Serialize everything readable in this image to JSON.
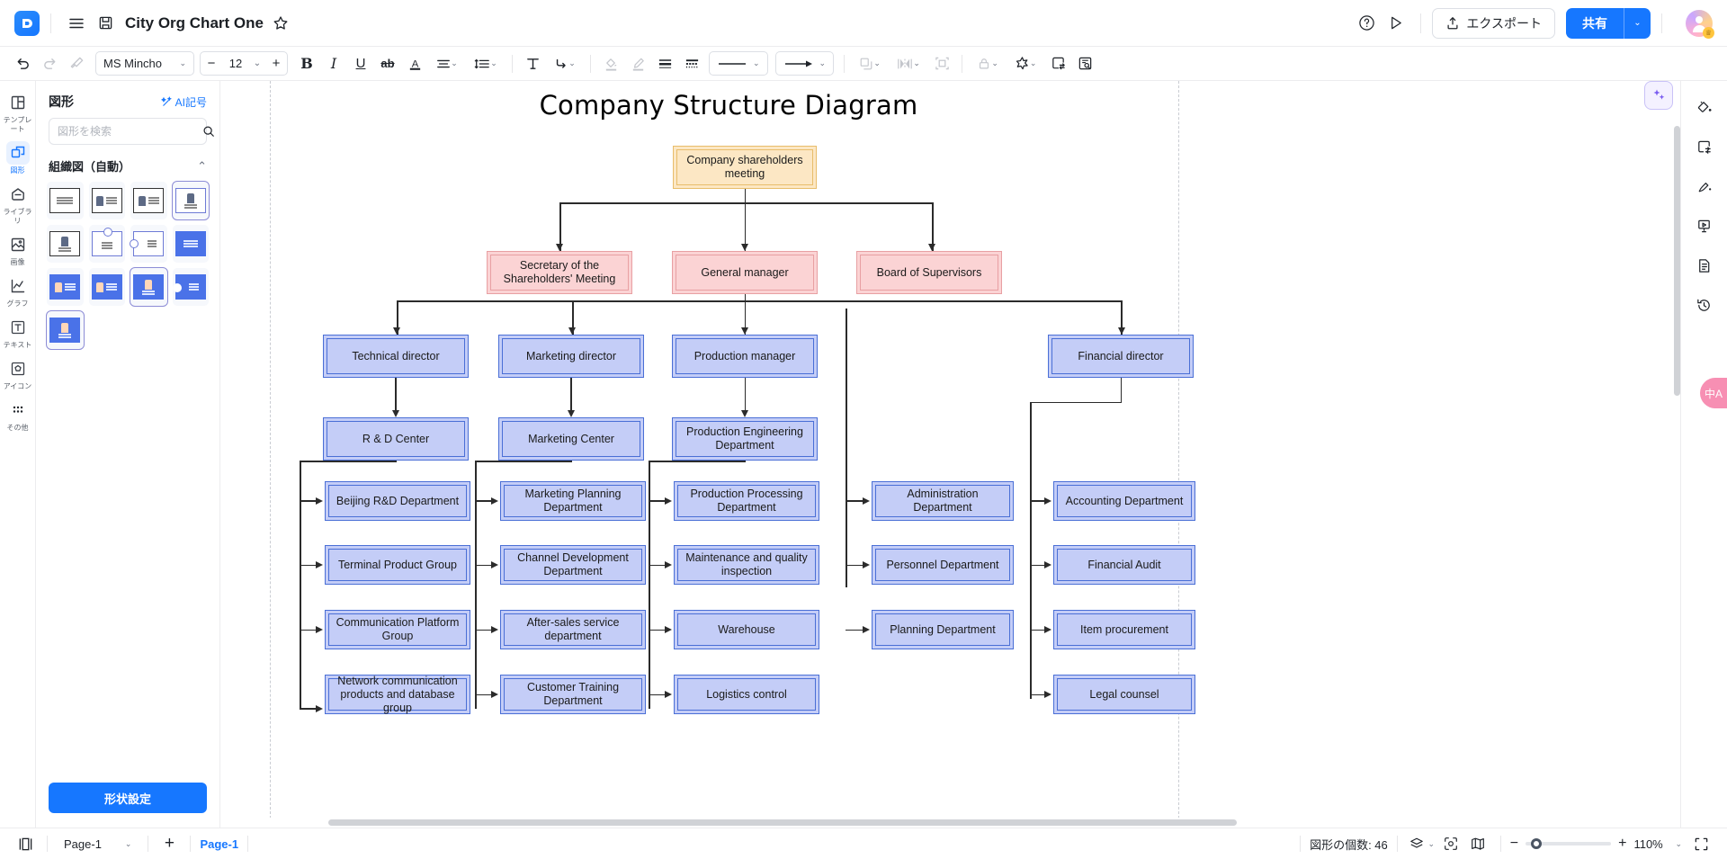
{
  "app": {
    "doc_title": "City Org Chart One",
    "logo_glyph": "⊃"
  },
  "topbar": {
    "menu_icon": "hamburger-icon",
    "save_icon": "save-icon",
    "star_icon": "★",
    "help_icon": "?",
    "present_icon": "▷",
    "export_label": "エクスポート",
    "share_label": "共有",
    "share_caret": "⌄"
  },
  "format_toolbar": {
    "undo": "↶",
    "redo": "↷",
    "format_painter": "brush-icon",
    "font_family": "MS Mincho",
    "font_size": "12",
    "minus": "−",
    "plus": "+",
    "bold": "B",
    "italic": "I",
    "underline": "U",
    "strikethrough": "ab",
    "font_color": "A",
    "align": "align-icon",
    "line_spacing": "line-spacing-icon",
    "text_box": "T",
    "connector": "connector-icon",
    "fill": "fill-icon",
    "line_color": "pen-icon",
    "line_weight": "weight-icon",
    "line_dash": "dash-icon",
    "line_style_preview": "———",
    "arrow_style_preview": "⟶",
    "arrange": "arrange-icon",
    "distribute": "distribute-icon",
    "group": "group-icon",
    "lock": "lock-icon",
    "effects": "star-effect-icon",
    "frame": "frame-icon",
    "find": "find-icon"
  },
  "left_rail": {
    "items": [
      {
        "label": "テンプレート",
        "icon": "template-icon",
        "active": false
      },
      {
        "label": "図形",
        "icon": "shapes-icon",
        "active": true
      },
      {
        "label": "ライブラリ",
        "icon": "library-icon",
        "active": false
      },
      {
        "label": "画像",
        "icon": "image-icon",
        "active": false
      },
      {
        "label": "グラフ",
        "icon": "chart-icon",
        "active": false
      },
      {
        "label": "テキスト",
        "icon": "text-icon",
        "active": false
      },
      {
        "label": "アイコン",
        "icon": "icon-icon",
        "active": false
      },
      {
        "label": "その他",
        "icon": "more-icon",
        "active": false
      }
    ]
  },
  "shape_panel": {
    "title": "図形",
    "ai_label": "AI記号",
    "search_placeholder": "図形を検索",
    "search_value": "",
    "group_title": "組織図（自動）",
    "collapse_caret": "⌃",
    "footer_button": "形状設定"
  },
  "canvas": {
    "title": "Company Structure Diagram",
    "ai_icon": "sparkle-icon"
  },
  "chart_data": {
    "type": "diagram",
    "title": "Company Structure Diagram",
    "nodes": {
      "root": "Company shareholders meeting",
      "level2": [
        "Secretary of the Shareholders' Meeting",
        "General manager",
        "Board of Supervisors"
      ],
      "level3": [
        "Technical director",
        "Marketing director",
        "Production manager",
        "Financial director"
      ],
      "level4": [
        "R & D Center",
        "Marketing Center",
        "Production Engineering Department",
        "Administration Department",
        "Accounting Department"
      ],
      "col_technical": [
        "Beijing R&D Department",
        "Terminal Product Group",
        "Communication Platform Group",
        "Network communication products and database group"
      ],
      "col_marketing": [
        "Marketing Planning Department",
        "Channel Development Department",
        "After-sales service department",
        "Customer Training Department"
      ],
      "col_production": [
        "Production Processing Department",
        "Maintenance and quality inspection",
        "Warehouse",
        "Logistics control"
      ],
      "col_admin": [
        "Administration Department",
        "Personnel Department",
        "Planning Department"
      ],
      "col_finance": [
        "Accounting Department",
        "Financial Audit",
        "Item procurement",
        "Legal counsel"
      ]
    },
    "colors": {
      "root_fill": "#fce7c4",
      "root_border": "#e8bd6b",
      "level2_fill": "#fbd3d4",
      "level2_border": "#e8a0a3",
      "dept_fill": "#c4cdf7",
      "dept_border": "#4a6fd6",
      "connector": "#2b2b2b"
    }
  },
  "right_rail": {
    "items": [
      {
        "icon": "fill-bucket-icon"
      },
      {
        "icon": "layout-settings-icon"
      },
      {
        "icon": "theme-brush-icon"
      },
      {
        "icon": "presentation-icon"
      },
      {
        "icon": "notes-icon"
      },
      {
        "icon": "history-icon"
      }
    ],
    "lang_pill": "中A"
  },
  "statusbar": {
    "panel_toggle_icon": "panel-toggle-icon",
    "page_select": "Page-1",
    "add_page_icon": "+",
    "page_tab": "Page-1",
    "shape_count": "図形の個数: 46",
    "layers_icon": "layers-icon",
    "focus_icon": "focus-icon",
    "map_icon": "map-icon",
    "zoom_minus": "−",
    "zoom_plus": "+",
    "zoom_value": "110%",
    "zoom_caret": "⌄",
    "fullscreen_icon": "fullscreen-icon"
  }
}
